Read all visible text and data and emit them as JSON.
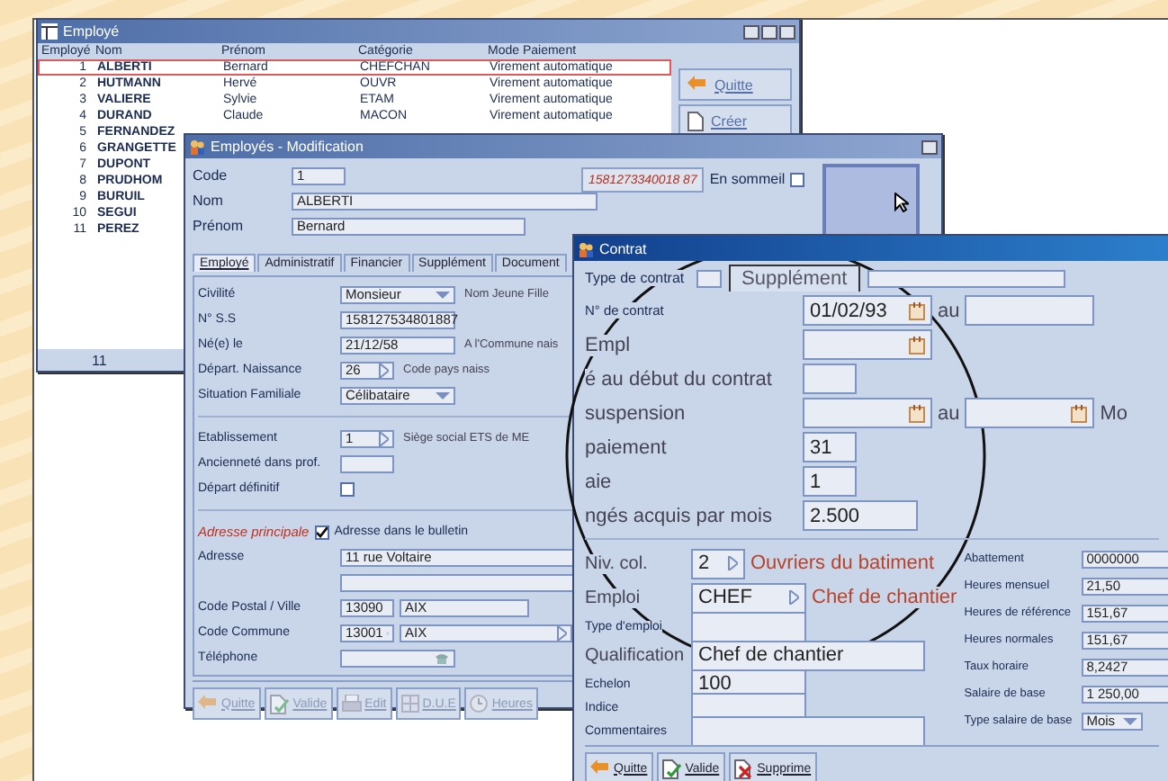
{
  "window_list": {
    "title": "Employé",
    "columns": [
      "Employé",
      "Nom",
      "Prénom",
      "Catégorie",
      "Mode Paiement"
    ],
    "rows": [
      {
        "cells": [
          "1",
          "ALBERTI",
          "Bernard",
          "CHEFCHAN",
          "Virement automatique"
        ],
        "selected": true
      },
      {
        "cells": [
          "2",
          "HUTMANN",
          "Hervé",
          "OUVR",
          "Virement automatique"
        ],
        "selected": false
      },
      {
        "cells": [
          "3",
          "VALIERE",
          "Sylvie",
          "ETAM",
          "Virement automatique"
        ],
        "selected": false
      },
      {
        "cells": [
          "4",
          "DURAND",
          "Claude",
          "MACON",
          "Virement automatique"
        ],
        "selected": false
      },
      {
        "cells": [
          "5",
          "FERNANDEZ"
        ],
        "selected": false
      },
      {
        "cells": [
          "6",
          "GRANGETTE"
        ],
        "selected": false
      },
      {
        "cells": [
          "7",
          "DUPONT"
        ],
        "selected": false
      },
      {
        "cells": [
          "8",
          "PRUDHOM"
        ],
        "selected": false
      },
      {
        "cells": [
          "9",
          "BURUIL"
        ],
        "selected": false
      },
      {
        "cells": [
          "10",
          "SEGUI"
        ],
        "selected": false
      },
      {
        "cells": [
          "11",
          "PEREZ"
        ],
        "selected": false
      }
    ],
    "buttons": [
      {
        "label": "Quitte",
        "kind": "quit"
      },
      {
        "label": "Créer",
        "kind": "new"
      }
    ],
    "status": "11"
  },
  "window_edit": {
    "title": "Employés - Modification",
    "fields": [
      {
        "label": "Code",
        "value": "1",
        "kind": "short"
      },
      {
        "label": "Nom",
        "value": "ALBERTI",
        "kind": "wide"
      },
      {
        "label": "Prénom",
        "value": "Bernard",
        "kind": "long"
      }
    ],
    "ss_button": "1581273340018 87",
    "sleep": {
      "label": "En sommeil",
      "checked": false
    },
    "tabs": [
      {
        "label": "Employé",
        "selected": true
      },
      {
        "label": "Administratif",
        "selected": false
      },
      {
        "label": "Financier",
        "selected": false
      },
      {
        "label": "Supplément",
        "selected": false
      },
      {
        "label": "Document",
        "selected": false
      }
    ],
    "rows": [
      {
        "label": "Civilité",
        "field": {
          "value": "Monsieur",
          "kind": "combo"
        },
        "side": "Nom Jeune Fille"
      },
      {
        "label": "N° S.S",
        "field": {
          "value": "158127534801887",
          "kind": "mid"
        }
      },
      {
        "label": "Né(e) le",
        "field": {
          "value": "21/12/58",
          "kind": "mid"
        },
        "side": "A l'Commune nais"
      },
      {
        "label": "Départ. Naissance",
        "field": {
          "value": "26",
          "kind": "code"
        },
        "side": "Code pays naiss"
      },
      {
        "label": "Situation Familiale",
        "field": {
          "value": "Célibataire",
          "kind": "combo"
        }
      }
    ],
    "rows2": [
      {
        "label": "Etablissement",
        "field": {
          "value": "1",
          "kind": "code"
        },
        "side": "Siège social  ETS de ME"
      },
      {
        "label": "Ancienneté dans prof.",
        "field": {
          "kind": "short"
        }
      },
      {
        "label": "Départ définitif",
        "checked": false
      }
    ],
    "address": {
      "title": "Adresse principale",
      "in_bulletin": {
        "label": "Adresse dans le bulletin",
        "checked": true
      },
      "rows": [
        {
          "label": "Adresse",
          "fields": [
            {
              "value": "11 rue Voltaire",
              "kind": "long"
            }
          ]
        },
        {
          "fields": [
            {
              "kind": "long"
            }
          ]
        },
        {
          "label": "Code Postal / Ville",
          "fields": [
            {
              "value": "13090",
              "kind": "short"
            },
            {
              "value": "AIX",
              "kind": "field"
            }
          ]
        },
        {
          "label": "Code Commune",
          "fields": [
            {
              "value": "13001",
              "kind": "code"
            },
            {
              "value": "AIX",
              "kind": "reference"
            }
          ]
        },
        {
          "label": "Téléphone",
          "fields": [
            {
              "kind": "phone"
            }
          ]
        }
      ]
    },
    "buttons": [
      {
        "label": "Quitte",
        "kind": "quit",
        "disabled": true
      },
      {
        "label": "Valide",
        "kind": "validate",
        "disabled": true
      },
      {
        "label": "Edit",
        "kind": "print",
        "disabled": true
      },
      {
        "label": "D.U.E",
        "kind": "due",
        "disabled": true
      },
      {
        "label": "Heures",
        "kind": "clock",
        "disabled": true
      }
    ]
  },
  "contract": {
    "title": "Contrat",
    "type_label": "Type de contrat",
    "tab": {
      "label": "Supplément",
      "selected": true
    },
    "lens_rows": [
      {
        "kind": "plain",
        "label": "N° de contrat",
        "items": [
          {
            "kind": "date",
            "value": "01/02/93"
          },
          {
            "kind": "text",
            "text": "au"
          },
          {
            "kind": "field"
          }
        ]
      },
      {
        "kind": "lens",
        "label": "Empl",
        "items": [
          {
            "kind": "date"
          }
        ]
      },
      {
        "kind": "lens",
        "label": "é au début du contrat",
        "items": [
          {
            "kind": "short"
          }
        ]
      },
      {
        "kind": "lens",
        "label": "suspension",
        "items": [
          {
            "kind": "date"
          },
          {
            "kind": "text",
            "text": "au"
          },
          {
            "kind": "date"
          },
          {
            "kind": "text",
            "text": "Mo"
          }
        ]
      },
      {
        "kind": "lens",
        "label": "paiement",
        "items": [
          {
            "kind": "short",
            "value": "31"
          }
        ]
      },
      {
        "kind": "lens",
        "label": "aie",
        "items": [
          {
            "kind": "short",
            "value": "1"
          }
        ]
      },
      {
        "kind": "lens",
        "label": "ngés acquis par mois",
        "items": [
          {
            "kind": "mid",
            "value": "2.500"
          }
        ]
      }
    ],
    "left_rows": [
      {
        "kind": "lens",
        "label": "Niv. col.",
        "items": [
          {
            "kind": "code",
            "value": "2"
          },
          {
            "kind": "note",
            "text": "Ouvriers du batiment"
          }
        ]
      },
      {
        "kind": "lens",
        "label": "Emploi",
        "items": [
          {
            "kind": "choice",
            "value": "CHEF"
          },
          {
            "kind": "note",
            "text": "Chef de chantier"
          }
        ]
      },
      {
        "kind": "plain",
        "label": "Type d'emploi",
        "items": [
          {
            "kind": "mid"
          }
        ]
      },
      {
        "kind": "lens",
        "label": "Qualification",
        "items": [
          {
            "kind": "long",
            "value": "Chef de chantier"
          }
        ]
      },
      {
        "kind": "plain",
        "label": "Echelon",
        "items": [
          {
            "kind": "mid",
            "value": "100"
          }
        ]
      },
      {
        "kind": "plain",
        "label": "Indice",
        "items": [
          {
            "kind": "mid"
          }
        ]
      },
      {
        "kind": "plain",
        "label": "Commentaires",
        "items": [
          {
            "kind": "long"
          }
        ]
      }
    ],
    "right_rows": [
      {
        "label": "Abattement",
        "value": "0000000",
        "kind": "mid"
      },
      {
        "label": "Heures mensuel",
        "value": "21,50",
        "kind": "mid"
      },
      {
        "label": "Heures de référence",
        "value": "151,67",
        "kind": "mid"
      },
      {
        "label": "Heures normales",
        "value": "151,67",
        "kind": "mid"
      },
      {
        "label": "Taux horaire",
        "value": "8,2427",
        "kind": "mid"
      },
      {
        "label": "Salaire de base",
        "value": "1 250,00",
        "kind": "mid"
      },
      {
        "label": "Type salaire de base",
        "value": "Mois",
        "kind": "unit"
      }
    ],
    "buttons": [
      {
        "label": "Quitte",
        "kind": "quit"
      },
      {
        "label": "Valide",
        "kind": "validate"
      },
      {
        "label": "Supprime",
        "kind": "delete"
      }
    ]
  }
}
